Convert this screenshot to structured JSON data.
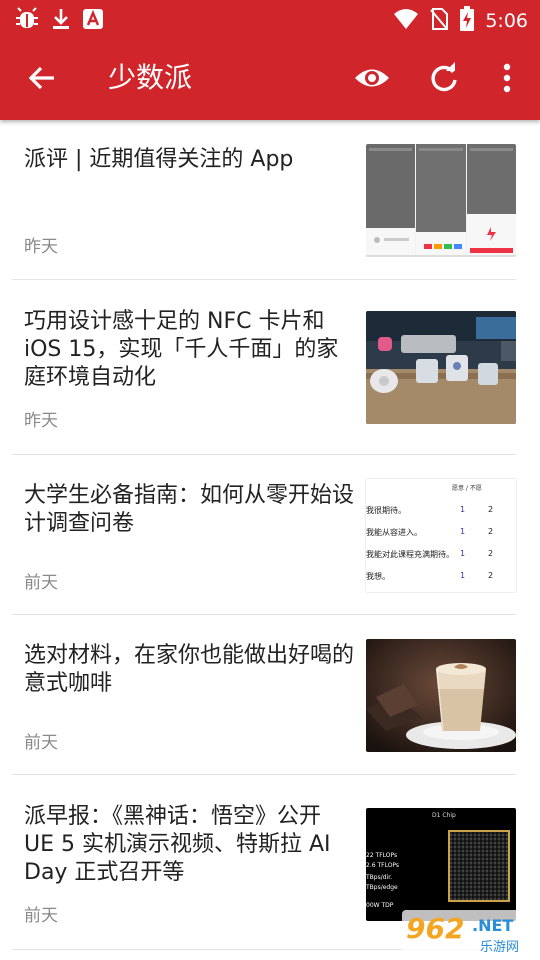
{
  "status_bar": {
    "time": "5:06"
  },
  "toolbar": {
    "title": "少数派"
  },
  "articles": [
    {
      "title": "派评 | 近期值得关注的 App",
      "date": "昨天"
    },
    {
      "title": "巧用设计感十足的 NFC 卡片和 iOS 15，实现「千人千面」的家庭环境自动化",
      "date": "昨天"
    },
    {
      "title": "大学生必备指南：如何从零开始设计调查问卷",
      "date": "前天"
    },
    {
      "title": "选对材料，在家你也能做出好喝的意式咖啡",
      "date": "前天"
    },
    {
      "title": "派早报：《黑神话：悟空》公开 UE 5 实机演示视频、特斯拉 AI Day 正式召开等",
      "date": "前天"
    }
  ],
  "thumb_texts": {
    "survey_header": "愿意 / 不愿",
    "survey_rows": [
      {
        "label": "我很期待。",
        "a": "1",
        "b": "2"
      },
      {
        "label": "我能从容进入。",
        "a": "1",
        "b": "2"
      },
      {
        "label": "我能对此课程充满期待。",
        "a": "1",
        "b": "2"
      },
      {
        "label": "我想。",
        "a": "1",
        "b": "2"
      }
    ],
    "chip_title": "D1 Chip",
    "chip_specs": [
      "22 TFLOPs",
      "2.6 TFLOPs",
      "TBps/dir.",
      "TBps/edge",
      "00W TDP"
    ]
  },
  "watermark": {
    "number": "962",
    "suffix": ".NET",
    "sub": "乐游网"
  },
  "colors": {
    "app_bar": "#d0262b",
    "divider": "#e4e4e4",
    "date_text": "#8a8a8a"
  }
}
